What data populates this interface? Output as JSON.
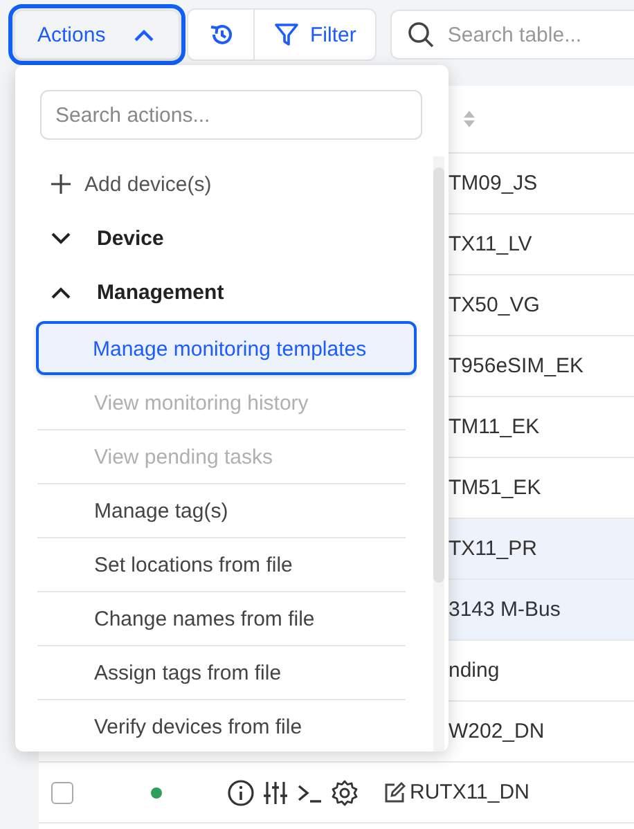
{
  "toolbar": {
    "actions_button": {
      "label": "Actions",
      "expanded": true
    },
    "filter_button": {
      "label": "Filter"
    },
    "search": {
      "placeholder": "Search table..."
    }
  },
  "table": {
    "rows": [
      {
        "kind": "partial",
        "name": "TM09_JS",
        "highlighted": false
      },
      {
        "kind": "partial",
        "name": "TX11_LV",
        "highlighted": false
      },
      {
        "kind": "partial",
        "name": "TX50_VG",
        "highlighted": false
      },
      {
        "kind": "partial",
        "name": "T956eSIM_EK",
        "highlighted": false
      },
      {
        "kind": "partial",
        "name": "TM11_EK",
        "highlighted": false
      },
      {
        "kind": "partial",
        "name": "TM51_EK",
        "highlighted": false
      },
      {
        "kind": "partial",
        "name": "TX11_PR",
        "highlighted": true
      },
      {
        "kind": "partial",
        "name": "3143 M-Bus",
        "highlighted": true
      },
      {
        "kind": "partial",
        "name": "nding",
        "highlighted": false
      },
      {
        "kind": "partial",
        "name": "W202_DN",
        "highlighted": false
      },
      {
        "kind": "full",
        "name": "RUTX11_DN",
        "highlighted": false,
        "checked": false,
        "color": "#2e9e5b"
      }
    ]
  },
  "dropdown": {
    "search": {
      "placeholder": "Search actions..."
    },
    "items": [
      {
        "kind": "action",
        "label": "Add device(s)"
      },
      {
        "kind": "group",
        "label": "Device",
        "expanded": false
      },
      {
        "kind": "group",
        "label": "Management",
        "expanded": true,
        "children": [
          {
            "label": "Manage monitoring templates",
            "disabled": false,
            "selected": true
          },
          {
            "label": "View monitoring history",
            "disabled": true,
            "selected": false
          },
          {
            "label": "View pending tasks",
            "disabled": true,
            "selected": false
          },
          {
            "label": "Manage tag(s)",
            "disabled": false,
            "selected": false
          },
          {
            "label": "Set locations from file",
            "disabled": false,
            "selected": false
          },
          {
            "label": "Change names from file",
            "disabled": false,
            "selected": false
          },
          {
            "label": "Assign tags from file",
            "disabled": false,
            "selected": false
          },
          {
            "label": "Verify devices from file",
            "disabled": false,
            "selected": false
          }
        ]
      }
    ]
  }
}
